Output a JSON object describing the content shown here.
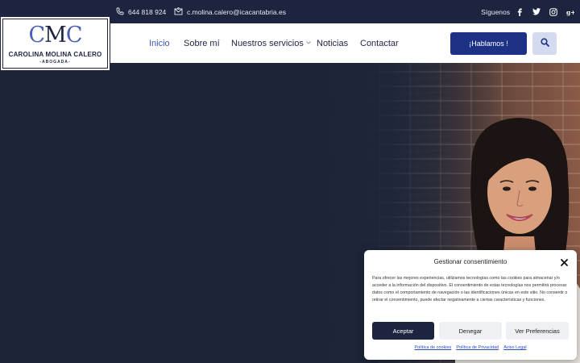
{
  "topbar": {
    "phone": "644 818 924",
    "email": "c.molina.calero@icacantabria.es",
    "follow_label": "Síguenos",
    "social_icons": [
      "facebook-icon",
      "twitter-icon",
      "instagram-icon",
      "google-plus-icon"
    ]
  },
  "logo": {
    "mark": "CMC",
    "name": "CAROLINA MOLINA CALERO",
    "subtitle": "-ABOGADA-"
  },
  "nav": {
    "items": [
      {
        "label": "Inicio",
        "active": true
      },
      {
        "label": "Sobre mí"
      },
      {
        "label": "Nuestros servicios",
        "has_dropdown": true
      },
      {
        "label": "Noticias"
      },
      {
        "label": "Contactar"
      }
    ],
    "cta_label": "¡Hablamos !",
    "search_icon": "search-icon"
  },
  "cookie": {
    "title": "Gestionar consentimiento",
    "body": "Para ofrecer las mejores experiencias, utilizamos tecnologías como las cookies para almacenar y/o acceder a la información del dispositivo. El consentimiento de estas tecnologías nos permitirá procesar datos como el comportamiento de navegación o las identificaciones únicas en este sitio. No consentir o retirar el consentimiento, puede afectar negativamente a ciertas características y funciones.",
    "accept": "Aceptar",
    "deny": "Denegar",
    "preferences": "Ver Preferencias",
    "links": [
      "Política de cookies",
      "Política de Privacidad",
      "Aviso Legal"
    ]
  },
  "colors": {
    "navy": "#1d2440",
    "accent": "#3d56b8",
    "cta": "#1d3287"
  }
}
